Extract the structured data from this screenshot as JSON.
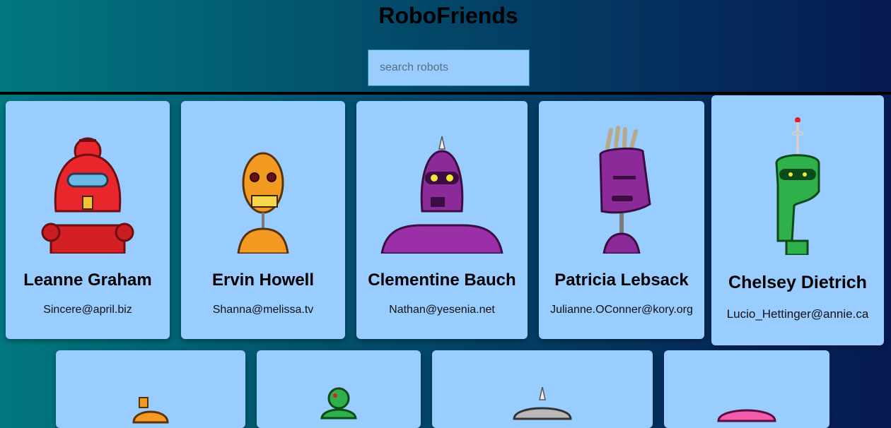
{
  "app": {
    "title": "RoboFriends"
  },
  "search": {
    "placeholder": "search robots",
    "value": ""
  },
  "robots": [
    {
      "name": "Leanne Graham",
      "email": "Sincere@april.biz",
      "robot_icon": "red-robot-icon"
    },
    {
      "name": "Ervin Howell",
      "email": "Shanna@melissa.tv",
      "robot_icon": "orange-robot-icon"
    },
    {
      "name": "Clementine Bauch",
      "email": "Nathan@yesenia.net",
      "robot_icon": "purple-robot-icon"
    },
    {
      "name": "Patricia Lebsack",
      "email": "Julianne.OConner@kory.org",
      "robot_icon": "purple-robot-icon"
    },
    {
      "name": "Chelsey Dietrich",
      "email": "Lucio_Hettinger@annie.ca",
      "robot_icon": "green-robot-icon"
    }
  ],
  "colors": {
    "card_background": "#99ccff",
    "page_gradient_start": "#02787f",
    "page_gradient_end": "#061a52"
  }
}
